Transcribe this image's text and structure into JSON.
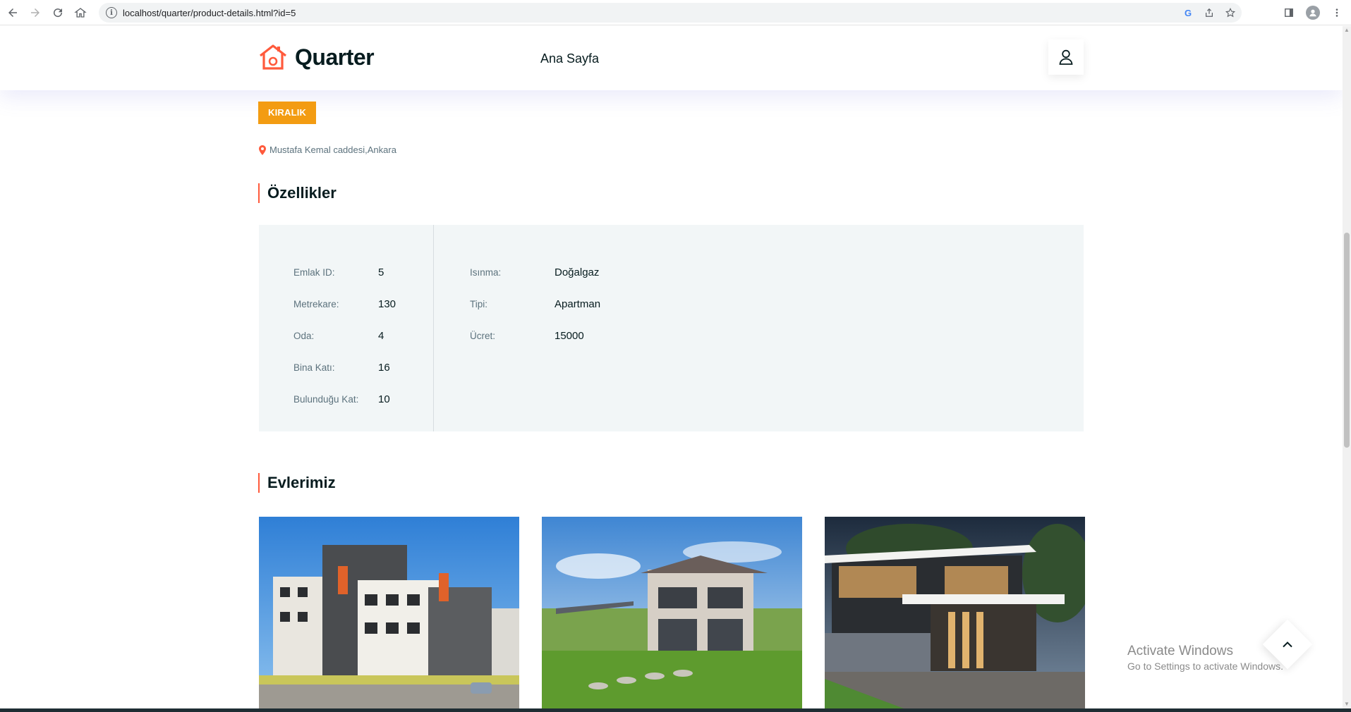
{
  "browser": {
    "url": "localhost/quarter/product-details.html?id=5"
  },
  "site": {
    "brand": "Quarter",
    "nav": [
      "Ana Sayfa"
    ]
  },
  "listing": {
    "status_badge": "KIRALIK",
    "address": "Mustafa Kemal caddesi,Ankara"
  },
  "features": {
    "title": "Özellikler",
    "left": [
      {
        "label": "Emlak ID:",
        "value": "5"
      },
      {
        "label": "Metrekare:",
        "value": "130"
      },
      {
        "label": "Oda:",
        "value": "4"
      },
      {
        "label": "Bina Katı:",
        "value": "16"
      },
      {
        "label": "Bulunduğu Kat:",
        "value": "10"
      }
    ],
    "right": [
      {
        "label": "Isınma:",
        "value": "Doğalgaz"
      },
      {
        "label": "Tipi:",
        "value": "Apartman"
      },
      {
        "label": "Ücret:",
        "value": "15000"
      }
    ]
  },
  "homes": {
    "title": "Evlerimiz"
  },
  "windows_notice": {
    "line1": "Activate Windows",
    "line2": "Go to Settings to activate Windows."
  },
  "colors": {
    "accent": "#ff5a3c",
    "badge": "#f39c12",
    "panel": "#f2f6f7",
    "dark": "#071c1f"
  }
}
